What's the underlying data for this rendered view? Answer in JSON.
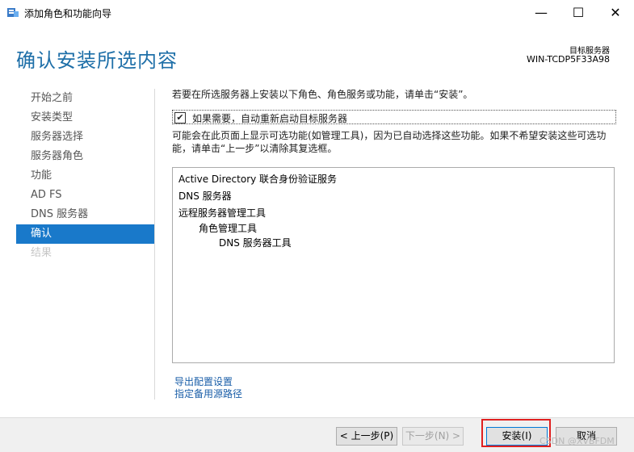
{
  "window": {
    "title": "添加角色和功能向导",
    "minimize": "—",
    "maximize": "☐",
    "close": "✕"
  },
  "header": {
    "title": "确认安装所选内容",
    "target_label": "目标服务器",
    "target_name": "WIN-TCDP5F33A98"
  },
  "nav": {
    "items": [
      {
        "label": "开始之前"
      },
      {
        "label": "安装类型"
      },
      {
        "label": "服务器选择"
      },
      {
        "label": "服务器角色"
      },
      {
        "label": "功能"
      },
      {
        "label": "AD FS"
      },
      {
        "label": "DNS 服务器"
      },
      {
        "label": "确认"
      },
      {
        "label": "结果"
      }
    ],
    "active_index": 7
  },
  "main": {
    "intro": "若要在所选服务器上安装以下角色、角色服务或功能，请单击“安装”。",
    "restart_checkbox": {
      "checked": true,
      "mark": "✔",
      "label": "如果需要，自动重新启动目标服务器"
    },
    "note": "可能会在此页面上显示可选功能(如管理工具)，因为已自动选择这些功能。如果不希望安装这些可选功能，请单击“上一步”以清除其复选框。",
    "list": [
      "Active Directory 联合身份验证服务",
      "DNS 服务器",
      "远程服务器管理工具",
      "角色管理工具",
      "DNS 服务器工具"
    ],
    "links": {
      "export": "导出配置设置",
      "alt_source": "指定备用源路径"
    }
  },
  "footer": {
    "prev": "< 上一步(P)",
    "next": "下一步(N) >",
    "install": "安装(I)",
    "cancel": "取消"
  },
  "watermark": "CSDN @XVBFDM"
}
